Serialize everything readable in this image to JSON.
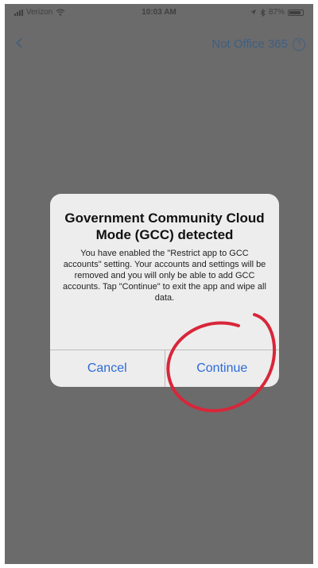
{
  "status_bar": {
    "carrier": "Verizon",
    "time": "10:03 AM",
    "battery": "87%"
  },
  "nav": {
    "right_link": "Not Office 365"
  },
  "alert": {
    "title": "Government Community Cloud Mode (GCC) detected",
    "message": "You have enabled the \"Restrict app to GCC accounts\" setting. Your accounts and settings will be removed and you will only be able to add GCC accounts. Tap \"Continue\" to exit the app and wipe all data.",
    "buttons": {
      "cancel": "Cancel",
      "continue": "Continue"
    }
  },
  "colors": {
    "overlay": "#6b6b6b",
    "alert_background": "#ededed",
    "button_blue": "#2d6bd6",
    "annotation_red": "#d8263a"
  },
  "icons": {
    "signal": "signal-icon",
    "wifi": "wifi-icon",
    "location": "location-icon",
    "bluetooth": "bluetooth-icon",
    "battery": "battery-icon",
    "back": "chevron-left-icon",
    "help": "question-circle-icon"
  }
}
